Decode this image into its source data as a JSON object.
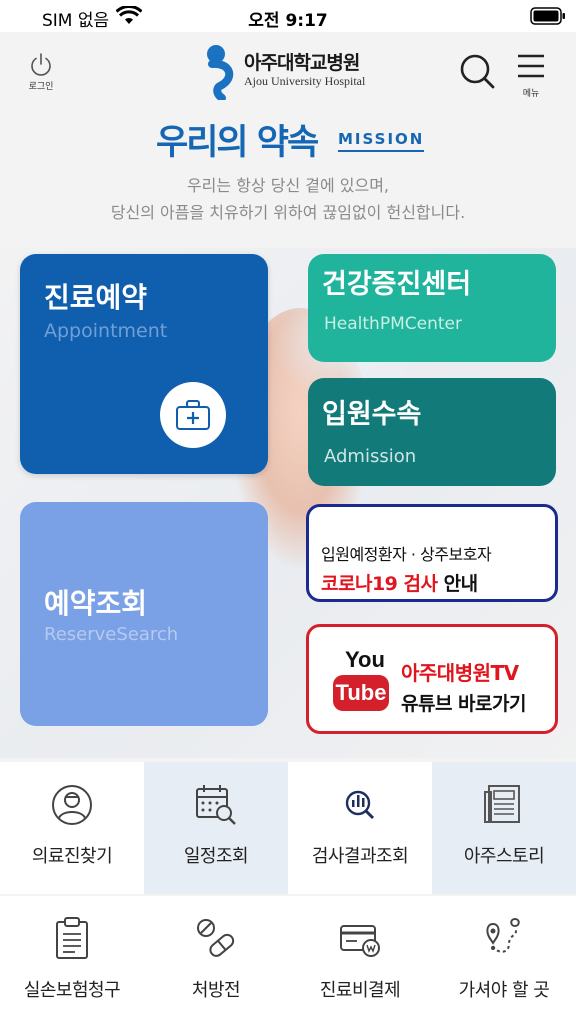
{
  "status_bar": {
    "carrier": "SIM 없음",
    "time": "오전 9:17",
    "wifi_icon": "wifi-icon",
    "battery_icon": "battery-icon"
  },
  "header": {
    "login_label": "로그인",
    "logo_ko": "아주대학교병원",
    "logo_en": "Ajou University Hospital",
    "menu_label": "메뉴"
  },
  "mission": {
    "title": "우리의 약속",
    "tag": "MISSION",
    "line1": "우리는 항상 당신 곁에 있으며,",
    "line2": "당신의 아픔을 치유하기 위하여 끊임없이 헌신합니다."
  },
  "tiles": {
    "appointment": {
      "ko": "진료예약",
      "en": "Appointment"
    },
    "health": {
      "ko": "건강증진센터",
      "en": "HealthPMCenter"
    },
    "admission": {
      "ko": "입원수속",
      "en": "Admission"
    },
    "reserve": {
      "ko": "예약조회",
      "en": "ReserveSearch"
    }
  },
  "banners": {
    "corona": {
      "line1": "입원예정환자 · 상주보호자",
      "line2_red": "코로나19 검사",
      "line2_black": " 안내"
    },
    "youtube": {
      "logo_you": "You",
      "logo_tube": "Tube",
      "title": "아주대병원TV",
      "subtitle": "유튜브 바로가기"
    }
  },
  "grid": [
    {
      "label": "의료진찾기",
      "icon": "doctor-icon"
    },
    {
      "label": "일정조회",
      "icon": "calendar-search-icon"
    },
    {
      "label": "검사결과조회",
      "icon": "test-result-search-icon"
    },
    {
      "label": "아주스토리",
      "icon": "newspaper-icon"
    },
    {
      "label": "실손보험청구",
      "icon": "clipboard-icon"
    },
    {
      "label": "처방전",
      "icon": "pills-icon"
    },
    {
      "label": "진료비결제",
      "icon": "card-payment-icon"
    },
    {
      "label": "가셔야 할 곳",
      "icon": "route-map-icon"
    }
  ],
  "colors": {
    "brand_blue": "#1567b3",
    "appointment": "#0f5fae",
    "health": "#1fb49b",
    "admission": "#127a78",
    "reserve": "#7aa0e6",
    "corona_border": "#1b2a8f",
    "youtube_red": "#d3202a"
  }
}
